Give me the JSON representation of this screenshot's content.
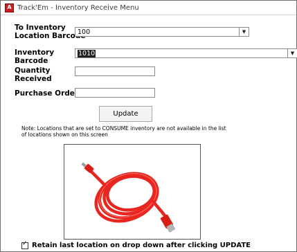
{
  "window": {
    "title": "Track'Em - Inventory Receive Menu",
    "app_icon_letter": "A"
  },
  "form": {
    "to_location": {
      "label_line1": "To Inventory",
      "label_line2": "Location Barcode",
      "value": "100"
    },
    "inventory_barcode": {
      "label_line1": "Inventory",
      "label_line2": "Barcode",
      "value": "1010"
    },
    "quantity_received": {
      "label_line1": "Quantity",
      "label_line2": "Received",
      "value": ""
    },
    "purchase_order": {
      "label": "Purchase Order",
      "value": ""
    },
    "update_label": "Update",
    "note": "Note: Locations that are set to CONSUME inventory are not available in the list of locations shown on this screen",
    "retain_label": "Retain last location on drop down after clicking UPDATE",
    "retain_checked": true
  },
  "icons": {
    "dropdown_arrow": "chevron-down-icon",
    "product_image": "red-usb-cable-image"
  },
  "colors": {
    "app_icon": "#c81f1f",
    "cable": "#e8261f"
  }
}
